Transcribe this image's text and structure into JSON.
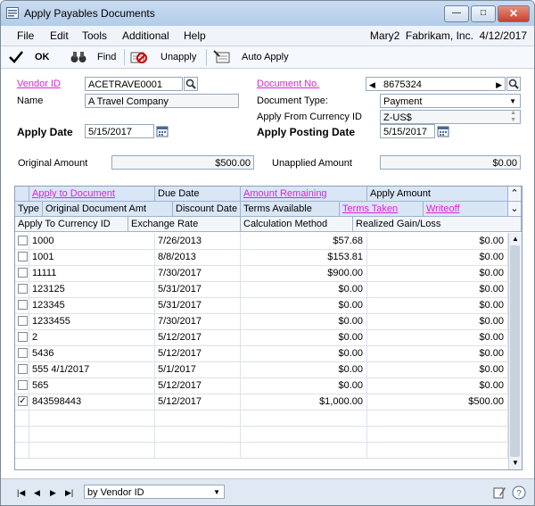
{
  "window": {
    "title": "Apply Payables Documents"
  },
  "window_buttons": {
    "minimize": "—",
    "maximize": "□",
    "close": "✕"
  },
  "menu": {
    "items": [
      "File",
      "Edit",
      "Tools",
      "Additional",
      "Help"
    ],
    "status": "Mary2  Fabrikam, Inc.  4/12/2017"
  },
  "toolbar": {
    "ok": "OK",
    "find": "Find",
    "unapply": "Unapply",
    "auto_apply": "Auto Apply"
  },
  "form": {
    "vendor_id_label": "Vendor ID",
    "vendor_id": "ACETRAVE0001",
    "name_label": "Name",
    "name": "A Travel Company",
    "apply_date_label": "Apply Date",
    "apply_date": "5/15/2017",
    "document_no_label": "Document No.",
    "document_no": "8675324",
    "document_type_label": "Document Type:",
    "document_type": "Payment",
    "currency_label": "Apply From Currency ID",
    "currency": "Z-US$",
    "posting_date_label": "Apply Posting Date",
    "posting_date": "5/15/2017",
    "original_amount_label": "Original Amount",
    "original_amount": "$500.00",
    "unapplied_amount_label": "Unapplied Amount",
    "unapplied_amount": "$0.00"
  },
  "grid": {
    "header1": [
      "Apply to Document",
      "Due Date",
      "Amount Remaining",
      "Apply Amount"
    ],
    "header2": [
      "Type",
      "Original Document Amt",
      "Discount Date",
      "Terms Available",
      "Terms Taken",
      "Writeoff"
    ],
    "header3": [
      "Apply To Currency ID",
      "Exchange Rate",
      "Calculation Method",
      "Realized Gain/Loss"
    ],
    "rows": [
      {
        "doc": "1000",
        "due": "7/26/2013",
        "remaining": "$57.68",
        "apply": "$0.00",
        "checked": ""
      },
      {
        "doc": "1001",
        "due": "8/8/2013",
        "remaining": "$153.81",
        "apply": "$0.00",
        "checked": ""
      },
      {
        "doc": "11111",
        "due": "7/30/2017",
        "remaining": "$900.00",
        "apply": "$0.00",
        "checked": ""
      },
      {
        "doc": "123125",
        "due": "5/31/2017",
        "remaining": "$0.00",
        "apply": "$0.00",
        "checked": ""
      },
      {
        "doc": "123345",
        "due": "5/31/2017",
        "remaining": "$0.00",
        "apply": "$0.00",
        "checked": ""
      },
      {
        "doc": "1233455",
        "due": "7/30/2017",
        "remaining": "$0.00",
        "apply": "$0.00",
        "checked": ""
      },
      {
        "doc": "2",
        "due": "5/12/2017",
        "remaining": "$0.00",
        "apply": "$0.00",
        "checked": ""
      },
      {
        "doc": "5436",
        "due": "5/12/2017",
        "remaining": "$0.00",
        "apply": "$0.00",
        "checked": ""
      },
      {
        "doc": "555 4/1/2017",
        "due": "5/1/2017",
        "remaining": "$0.00",
        "apply": "$0.00",
        "checked": ""
      },
      {
        "doc": "565",
        "due": "5/12/2017",
        "remaining": "$0.00",
        "apply": "$0.00",
        "checked": ""
      },
      {
        "doc": "843598443",
        "due": "5/12/2017",
        "remaining": "$1,000.00",
        "apply": "$500.00",
        "checked": "✓"
      }
    ]
  },
  "footer": {
    "sort_by": "by Vendor ID"
  },
  "icons": {
    "ok": "checkmark-icon",
    "find": "binoculars-icon",
    "unapply": "unapply-icon",
    "auto_apply": "auto-apply-icon",
    "lookup": "magnifier-icon",
    "calendar": "calendar-icon",
    "note": "note-icon",
    "help": "help-icon"
  },
  "colors": {
    "link": "#e020e0",
    "header_bg": "#d8e6f6",
    "window_bg": "#dfe8f3"
  }
}
